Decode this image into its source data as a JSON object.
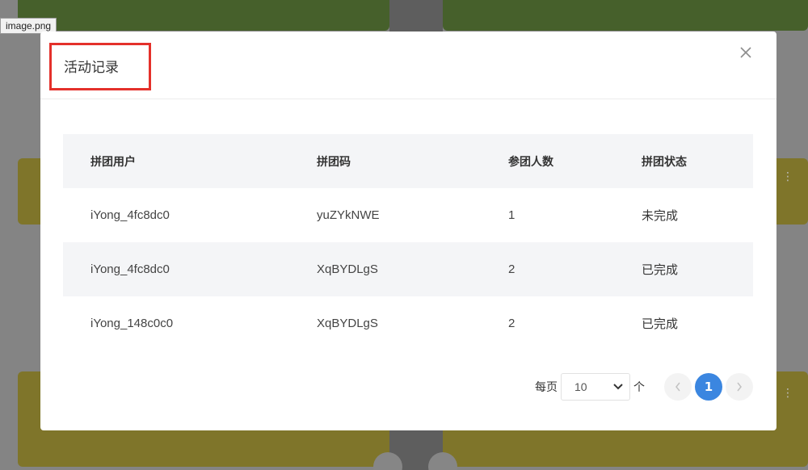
{
  "tooltip": {
    "filename": "image.png"
  },
  "modal": {
    "title": "活动记录",
    "close_icon": "close-icon"
  },
  "table": {
    "columns": [
      "拼团用户",
      "拼团码",
      "参团人数",
      "拼团状态"
    ],
    "rows": [
      {
        "user": "iYong_4fc8dc0",
        "code": "yuZYkNWE",
        "members": "1",
        "status": "未完成"
      },
      {
        "user": "iYong_4fc8dc0",
        "code": "XqBYDLgS",
        "members": "2",
        "status": "已完成"
      },
      {
        "user": "iYong_148c0c0",
        "code": "XqBYDLgS",
        "members": "2",
        "status": "已完成"
      }
    ]
  },
  "pagination": {
    "per_page_label": "每页",
    "page_size": "10",
    "unit_label": "个",
    "current_page": "1",
    "prev_icon": "chevron-left-icon",
    "next_icon": "chevron-right-icon"
  },
  "colors": {
    "accent": "#3b86e0",
    "highlight_box": "#e4302b"
  }
}
